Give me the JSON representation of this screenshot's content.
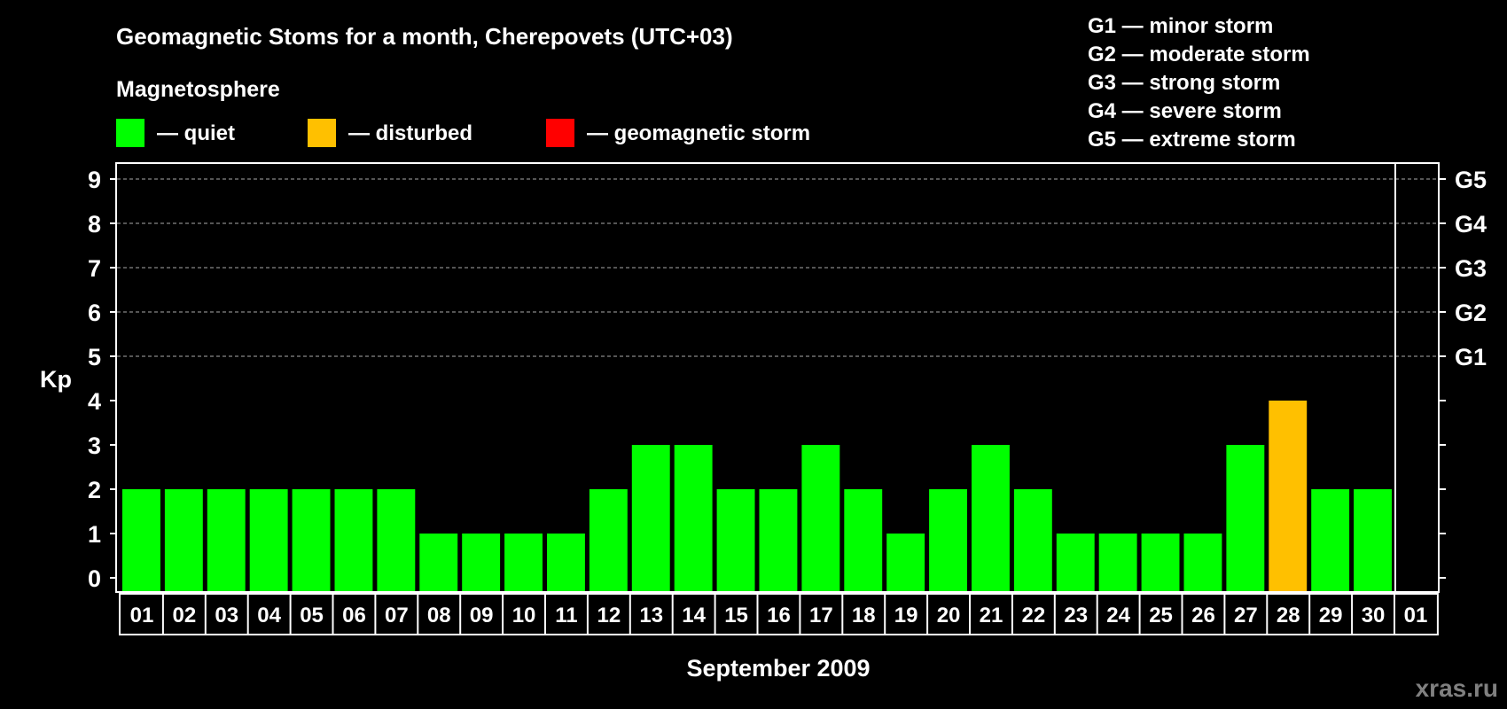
{
  "chart_data": {
    "type": "bar",
    "title": "Geomagnetic Stoms for a month, Cherepovets (UTC+03)",
    "legend_title": "Magnetosphere",
    "legend": [
      {
        "label": "— quiet",
        "color": "#00ff00"
      },
      {
        "label": "— disturbed",
        "color": "#ffc000"
      },
      {
        "label": "— geomagnetic storm",
        "color": "#ff0000"
      }
    ],
    "storm_scale": [
      "G1 — minor storm",
      "G2 — moderate storm",
      "G3 — strong storm",
      "G4 — severe storm",
      "G5 — extreme storm"
    ],
    "xlabel": "September 2009",
    "ylabel": "Kp",
    "ylim": [
      0,
      9
    ],
    "yticks": [
      0,
      1,
      2,
      3,
      4,
      5,
      6,
      7,
      8,
      9
    ],
    "right_ticks": [
      {
        "value": 5,
        "label": "G1"
      },
      {
        "value": 6,
        "label": "G2"
      },
      {
        "value": 7,
        "label": "G3"
      },
      {
        "value": 8,
        "label": "G4"
      },
      {
        "value": 9,
        "label": "G5"
      }
    ],
    "grid": "dashed at 5-9",
    "categories": [
      "01",
      "02",
      "03",
      "04",
      "05",
      "06",
      "07",
      "08",
      "09",
      "10",
      "11",
      "12",
      "13",
      "14",
      "15",
      "16",
      "17",
      "18",
      "19",
      "20",
      "21",
      "22",
      "23",
      "24",
      "25",
      "26",
      "27",
      "28",
      "29",
      "30",
      "01"
    ],
    "values": [
      2,
      2,
      2,
      2,
      2,
      2,
      2,
      1,
      1,
      1,
      1,
      2,
      3,
      3,
      2,
      2,
      3,
      2,
      1,
      2,
      3,
      2,
      1,
      1,
      1,
      1,
      3,
      4,
      2,
      2,
      null
    ],
    "colors": {
      "quiet": "#00ff00",
      "disturbed": "#ffc000",
      "storm": "#ff0000"
    }
  },
  "watermark": "xras.ru"
}
